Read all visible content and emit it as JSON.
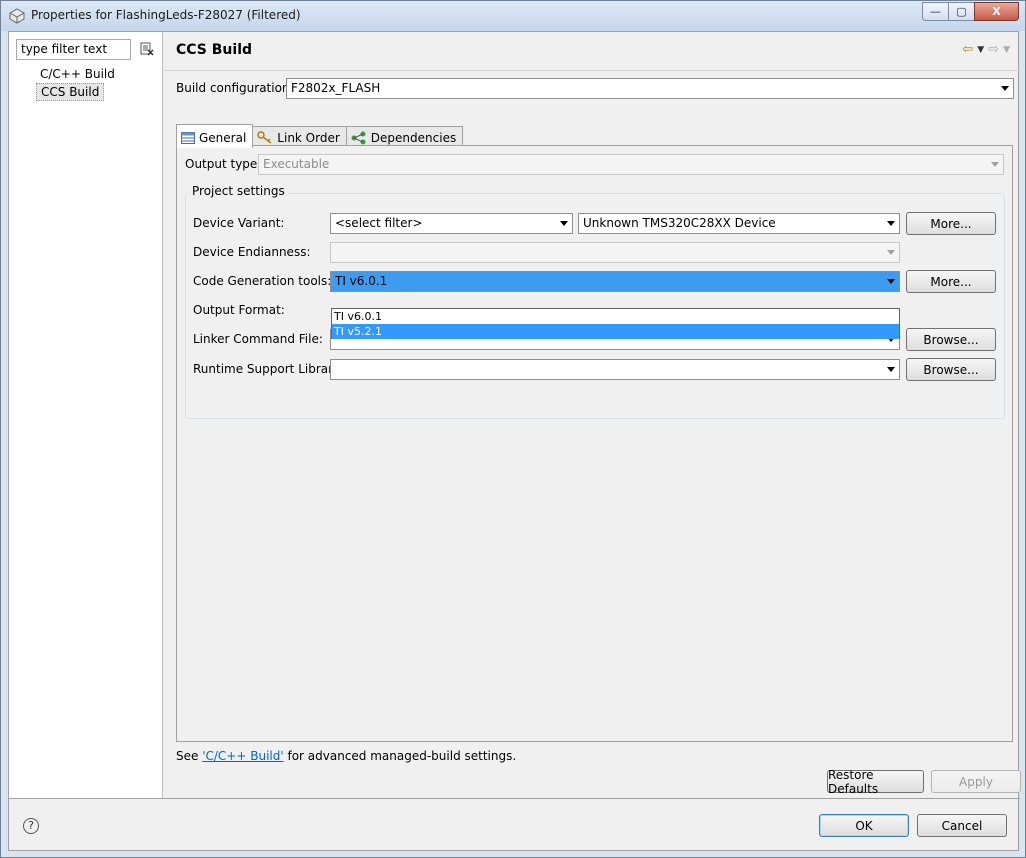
{
  "window": {
    "title": "Properties for FlashingLeds-F28027 (Filtered)",
    "min_label": "—",
    "max_label": "▢",
    "close_label": "X"
  },
  "sidebar": {
    "filter_placeholder": "type filter text",
    "filter_value": "type filter text",
    "items": [
      {
        "label": "C/C++ Build",
        "selected": false
      },
      {
        "label": "CCS Build",
        "selected": true
      }
    ]
  },
  "page": {
    "title": "CCS Build",
    "build_config_label": "Build configuration:",
    "build_config_value": "F2802x_FLASH"
  },
  "tabs": [
    {
      "label": "General",
      "icon": "grid-icon"
    },
    {
      "label": "Link Order",
      "icon": "key-icon"
    },
    {
      "label": "Dependencies",
      "icon": "dependencies-icon"
    }
  ],
  "general": {
    "output_type_label": "Output type:",
    "output_type_value": "Executable",
    "project_settings_label": "Project settings",
    "device_variant_label": "Device Variant:",
    "device_variant_filter": "<select filter>",
    "device_variant_value": "Unknown TMS320C28XX Device",
    "device_endianness_label": "Device Endianness:",
    "device_endianness_value": "",
    "codegen_label": "Code Generation tools:",
    "codegen_value": "TI v6.0.1",
    "codegen_options": [
      "TI v6.0.1",
      "TI v5.2.1"
    ],
    "output_format_label": "Output Format:",
    "linker_cmd_label": "Linker Command File:",
    "linker_cmd_value": "",
    "rts_label": "Runtime Support Library:",
    "rts_value": "",
    "more_label": "More...",
    "browse_label": "Browse..."
  },
  "footer": {
    "see_prefix": "See ",
    "see_link": "'C/C++ Build'",
    "see_suffix": " for advanced managed-build settings.",
    "restore_label": "Restore Defaults",
    "apply_label": "Apply",
    "ok_label": "OK",
    "cancel_label": "Cancel"
  }
}
